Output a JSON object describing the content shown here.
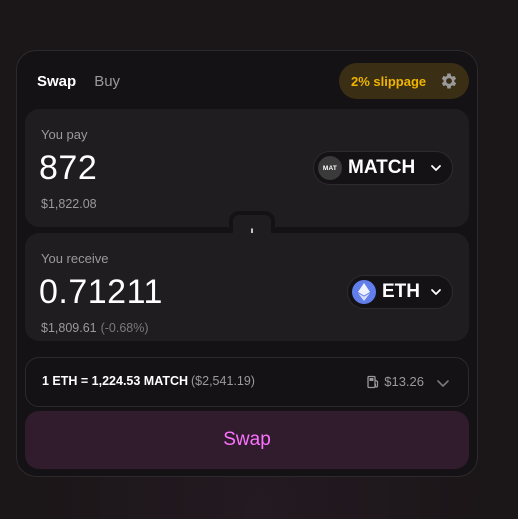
{
  "tabs": {
    "swap_label": "Swap",
    "buy_label": "Buy"
  },
  "settings": {
    "slippage_label": "2% slippage",
    "icon": "gear-icon"
  },
  "pay": {
    "label": "You pay",
    "amount": "872",
    "fiat": "$1,822.08",
    "token": {
      "symbol": "MATCH",
      "logo_text": "MAT",
      "icon": "match-token-logo"
    }
  },
  "receive": {
    "label": "You receive",
    "amount": "0.71211",
    "fiat": "$1,809.61",
    "fiat_delta": "(-0.68%)",
    "token": {
      "symbol": "ETH",
      "icon": "eth-token-logo"
    }
  },
  "rate": {
    "text": "1 ETH = 1,224.53 MATCH",
    "fiat": "($2,541.19)",
    "gas": "$13.26"
  },
  "cta": {
    "label": "Swap"
  },
  "colors": {
    "accent": "#fc72ff",
    "cta_bg": "#311c2e",
    "slippage_text": "#f0b400",
    "slippage_bg": "#3a2f14",
    "eth_blue": "#627eea"
  }
}
